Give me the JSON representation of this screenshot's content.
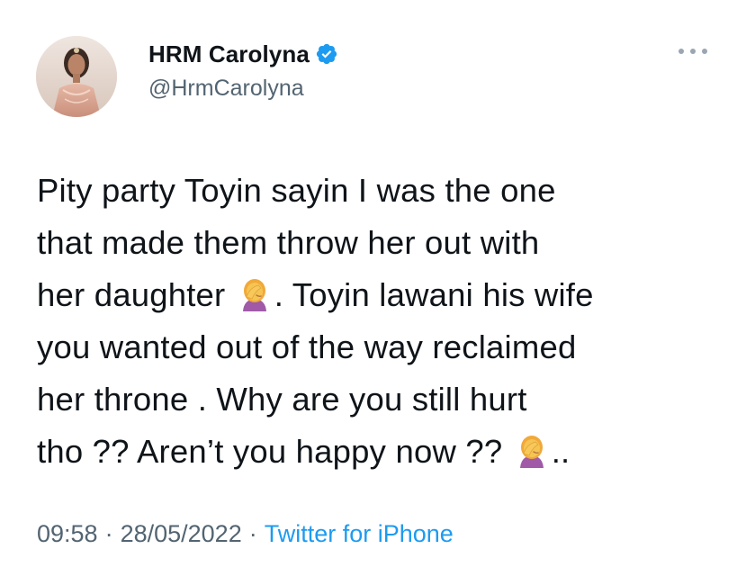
{
  "tweet": {
    "author": {
      "display_name": "HRM Carolyna",
      "handle": "@HrmCarolyna",
      "verified": true
    },
    "text_lines": [
      "Pity party Toyin sayin I was the one",
      "that made them throw her out with",
      "her daughter",
      ". Toyin lawani his wife",
      "you wanted out of the way reclaimed",
      "her throne . Why are you still hurt",
      "tho ?? Aren’t you happy now ??",
      ".."
    ],
    "emoji": "face-palm-emoji",
    "time": "09:58",
    "date": "28/05/2022",
    "source": "Twitter for iPhone",
    "separator": "·"
  },
  "colors": {
    "text": "#0f1419",
    "secondary": "#536471",
    "link": "#1d9bf0",
    "verified_badge": "#1d9bf0"
  },
  "icons": {
    "verified": "verified-badge-icon",
    "more": "more-options-icon",
    "emoji": "face-palm-emoji"
  }
}
